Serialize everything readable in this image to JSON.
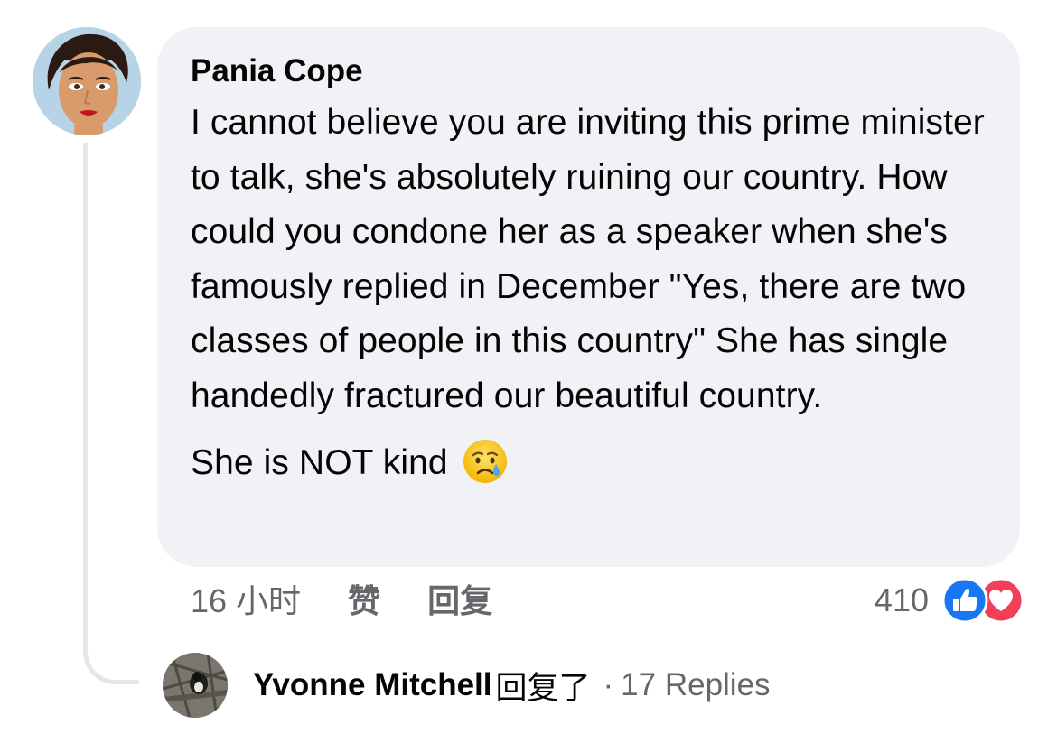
{
  "comment": {
    "author": "Pania Cope",
    "body_paragraphs": [
      "I cannot believe you are inviting this prime minister to talk, she's absolutely ruining our country. How could you condone her as a speaker when she's famously replied in December \"Yes, there are two classes of people in this country\" She has single handedly fractured our beautiful country."
    ],
    "closing_line": "She is NOT kind",
    "closing_emoji": "crying-face-emoji",
    "timestamp": "16 小时",
    "like_label": "赞",
    "reply_label": "回复",
    "reaction_count": "410",
    "reaction_icons": [
      "like-icon",
      "love-icon"
    ],
    "colors": {
      "bubble_bg": "#f0f2f5",
      "like_blue": "#1877f2",
      "love_red": "#f33e58",
      "secondary_text": "#65676b"
    }
  },
  "reply_summary": {
    "replier": "Yvonne Mitchell",
    "verb": "回复了",
    "separator": "·",
    "count_label": "17 Replies"
  }
}
